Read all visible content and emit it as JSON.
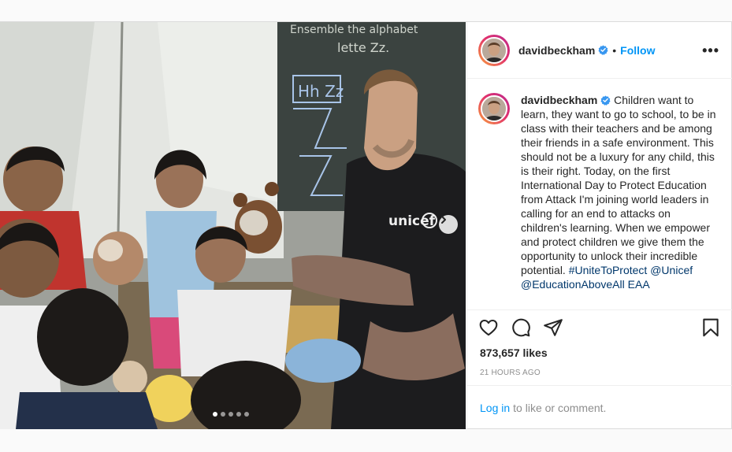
{
  "post": {
    "username": "davidbeckham",
    "follow_label": "Follow",
    "separator": "•",
    "more_label": "•••",
    "caption": "Children want to learn, they want to go to school, to be in class with their teachers and be among their friends in a safe environment. This should not be a luxury for any child, this is their right. Today, on the first International Day to Protect Education from Attack I'm joining world leaders in calling for an end to attacks on children's learning. When we empower and protect children we give them the opportunity to unlock their incredible potential.",
    "hashtag": "#UniteToProtect",
    "mentions": "@Unicef @EducationAboveAll",
    "caption_tail": "EAA",
    "likes": "873,657 likes",
    "time": "21 HOURS AGO",
    "login_label": "Log in",
    "comment_prompt": "to like or comment.",
    "carousel": {
      "total": 5,
      "current": 1
    },
    "photo_text": {
      "board_top": "Ensemble the alphabet",
      "board_letter_line": "lette Zz.",
      "board_hh": "Hh Zz",
      "shirt_logo": "unicef"
    }
  },
  "colors": {
    "link": "#0095f6",
    "hashtag": "#00376b",
    "text": "#262626",
    "muted": "#8e8e8e",
    "verified": "#3897f0"
  },
  "icons": [
    "verified-badge-icon",
    "more-options-icon",
    "heart-icon",
    "comment-icon",
    "share-icon",
    "bookmark-icon",
    "chevron-right-icon"
  ]
}
